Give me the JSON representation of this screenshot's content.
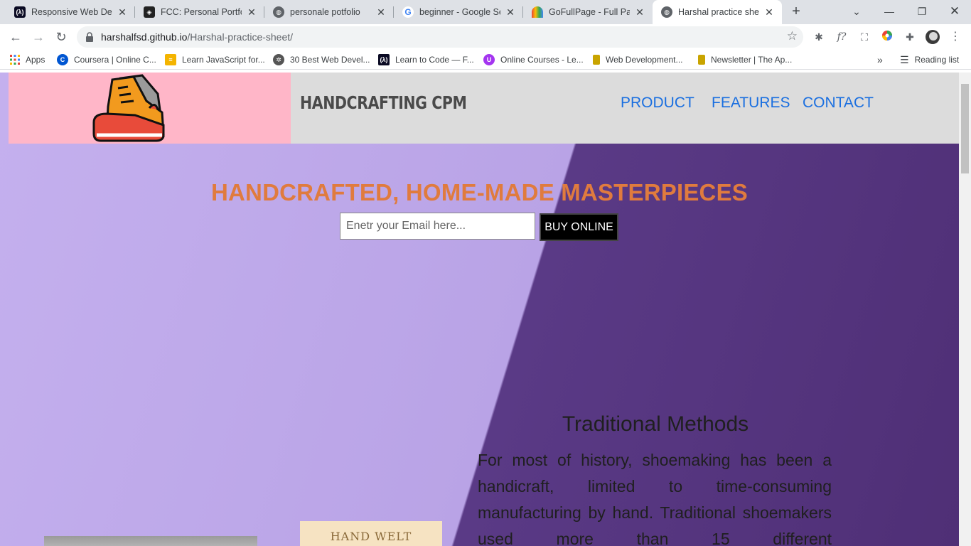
{
  "browser": {
    "tabs": [
      {
        "title": "Responsive Web Desig",
        "favicon": "fcc-icon",
        "active": false
      },
      {
        "title": "FCC: Personal Portfolio",
        "favicon": "codepen-icon",
        "active": false
      },
      {
        "title": "personale potfolio",
        "favicon": "globe-icon",
        "active": false
      },
      {
        "title": "beginner - Google Sea",
        "favicon": "google-icon",
        "active": false
      },
      {
        "title": "GoFullPage - Full Page",
        "favicon": "gofullpage-icon",
        "active": false
      },
      {
        "title": "Harshal practice sheet",
        "favicon": "globe-icon",
        "active": true
      }
    ],
    "address": {
      "host": "harshalfsd.github.io",
      "path": "/Harshal-practice-sheet/"
    },
    "bookmarks": [
      {
        "label": "Apps",
        "icon": "apps-grid-icon",
        "color": "#ea4335"
      },
      {
        "label": "Coursera | Online C...",
        "icon": "coursera-icon",
        "color": "#0056d2"
      },
      {
        "label": "Learn JavaScript for...",
        "icon": "scrimba-icon",
        "color": "#f4b400"
      },
      {
        "label": "30 Best Web Devel...",
        "icon": "hacker-icon",
        "color": "#555555"
      },
      {
        "label": "Learn to Code — F...",
        "icon": "fcc-icon",
        "color": "#0a0a23"
      },
      {
        "label": "Online Courses - Le...",
        "icon": "udemy-icon",
        "color": "#a435f0"
      },
      {
        "label": "Web Development...",
        "icon": "bookmark-icon",
        "color": "#c9a400"
      },
      {
        "label": "Newsletter | The Ap...",
        "icon": "bookmark-icon",
        "color": "#c9a400"
      }
    ],
    "reading_list": "Reading list"
  },
  "site": {
    "brand": "HANDCRAFTING CPM",
    "nav": [
      "PRODUCT",
      "FEATURES",
      "CONTACT"
    ],
    "hero_title": "HANDCRAFTED, HOME-MADE MASTERPIECES",
    "email_placeholder": "Enetr your Email here...",
    "buy_label": "BUY ONLINE",
    "feature_title": "Traditional Methods",
    "feature_text": "For most of history, shoemaking has been a handicraft, limited to time-consuming manufacturing by hand. Traditional shoemakers used more than 15 different",
    "hand_welt": "HAND WELT",
    "colors": {
      "hero_title": "#e07b3e",
      "nav": "#1a6fe0",
      "logo_bg": "#ffb6c8"
    }
  }
}
